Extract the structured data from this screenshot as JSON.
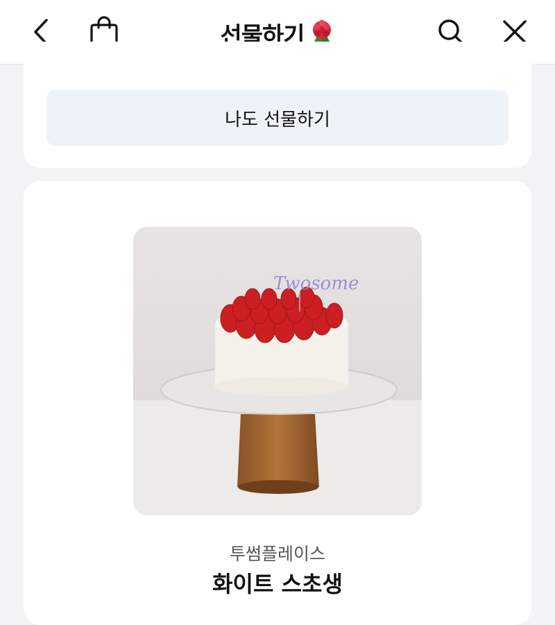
{
  "header": {
    "title": "선물하기",
    "icons": [
      "back-arrow-icon",
      "shopping-bag-icon",
      "carnation-icon",
      "search-icon",
      "close-icon"
    ]
  },
  "gift_section": {
    "button_label": "나도 선물하기"
  },
  "product": {
    "image_alt": "white strawberry shortcake on cake stand",
    "image_topper_text": "Twosome",
    "brand": "투썸플레이스",
    "name": "화이트 스초생"
  },
  "colors": {
    "background": "#f3f3f5",
    "card": "#ffffff",
    "button_bg": "#eef3fa"
  }
}
